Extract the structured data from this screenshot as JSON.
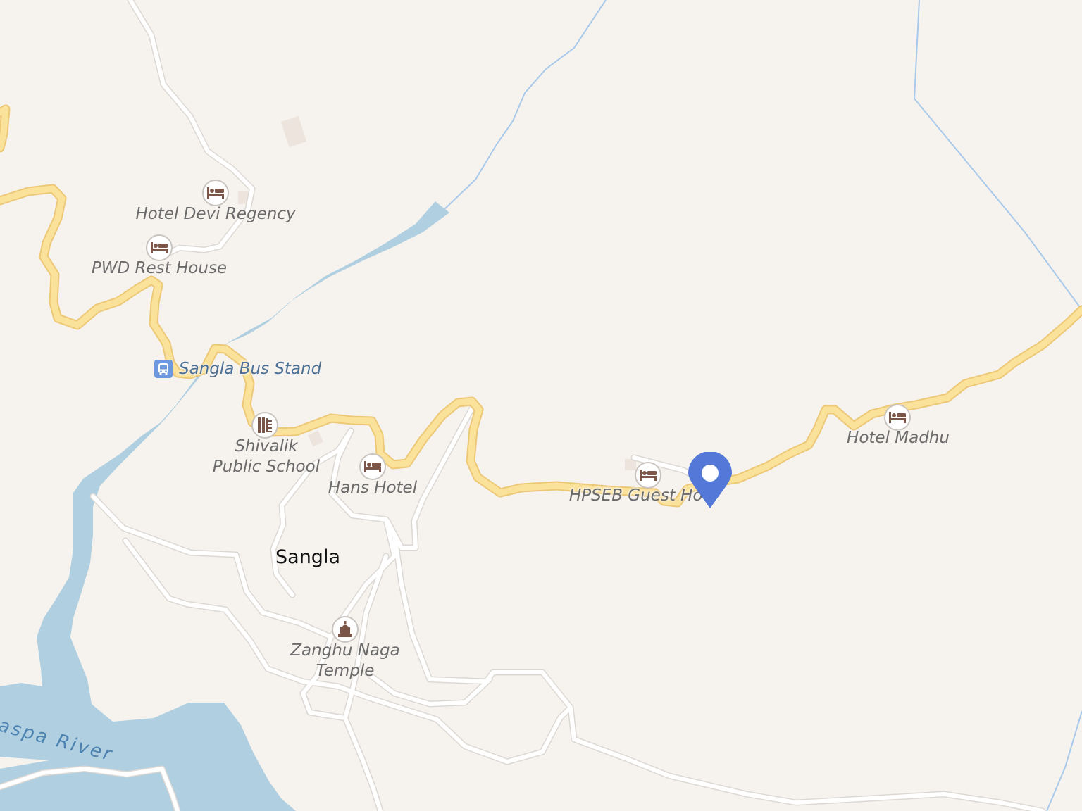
{
  "map": {
    "colors": {
      "land": "#f6f3ef",
      "water": "#b0cfe0",
      "stream": "#a8c9ea",
      "major_road": "#fbe29a",
      "major_road_casing": "#ecc877",
      "minor_road": "#ffffff",
      "minor_road_casing": "#dcd8d4",
      "marker": "#5478d8",
      "poi_icon": "#7a5548"
    },
    "place_label": "Sangla",
    "river_label": "Baspa River",
    "bus_stop": {
      "label": "Sangla Bus Stand",
      "icon": "bus-icon"
    },
    "pois": [
      {
        "id": "hotel-devi-regency",
        "label": "Hotel Devi Regency",
        "icon": "bed-icon"
      },
      {
        "id": "pwd-rest-house",
        "label": "PWD Rest House",
        "icon": "bed-icon"
      },
      {
        "id": "shivalik-public-school",
        "label_lines": [
          "Shivalik",
          "Public School"
        ],
        "icon": "school-icon"
      },
      {
        "id": "hans-hotel",
        "label": "Hans Hotel",
        "icon": "bed-icon"
      },
      {
        "id": "hpseb-guest-house",
        "label": "HPSEB Guest Hou",
        "icon": "bed-icon"
      },
      {
        "id": "hotel-madhu",
        "label": "Hotel Madhu",
        "icon": "bed-icon"
      },
      {
        "id": "zanghu-naga-temple",
        "label_lines": [
          "Zanghu Naga",
          "Temple"
        ],
        "icon": "temple-icon"
      }
    ],
    "marker": {
      "icon": "map-pin-icon"
    }
  }
}
